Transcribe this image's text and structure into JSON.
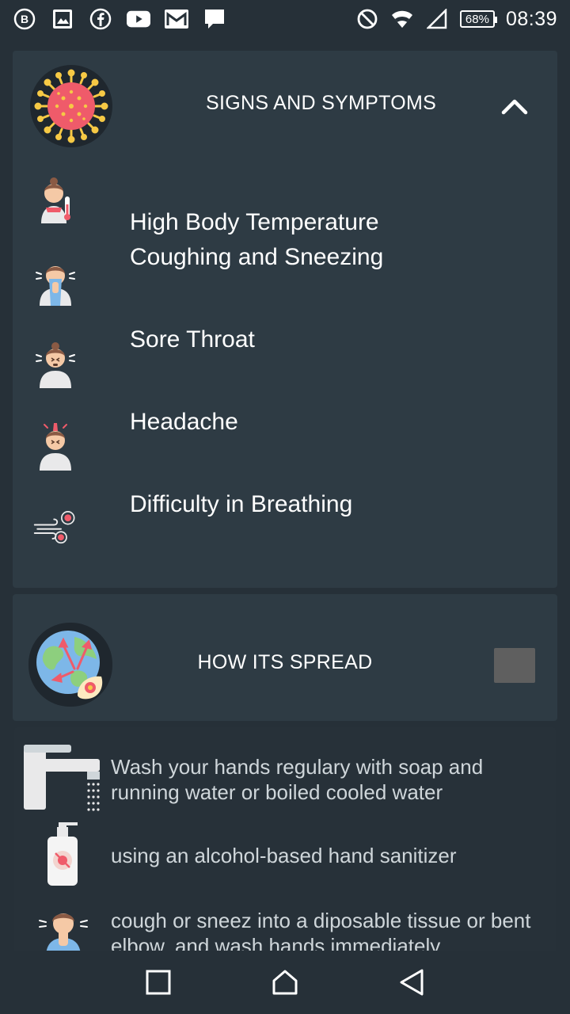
{
  "status_bar": {
    "left_icons": [
      "b-circle-icon",
      "image-icon",
      "facebook-icon",
      "youtube-icon",
      "gmail-icon",
      "chat-icon"
    ],
    "right_icons": [
      "do-not-disturb-icon",
      "wifi-icon",
      "signal-icon"
    ],
    "battery": "68%",
    "time": "08:39"
  },
  "signs_card": {
    "title": "SIGNS AND SYMPTOMS",
    "expanded": true,
    "items": [
      {
        "label": "High Body Temperature",
        "icon": "fever-person-icon"
      },
      {
        "label": "Coughing and Sneezing",
        "icon": "sneezing-person-icon"
      },
      {
        "label": "Sore Throat",
        "icon": "sore-throat-person-icon"
      },
      {
        "label": "Headache",
        "icon": "headache-person-icon"
      },
      {
        "label": "Difficulty in Breathing",
        "icon": "breathing-virus-icon"
      }
    ]
  },
  "spread_card": {
    "title": "HOW ITS SPREAD"
  },
  "prevention": {
    "items": [
      {
        "text": "Wash your hands regulary with soap and running water or boiled cooled water",
        "icon": "faucet-icon"
      },
      {
        "text": "using an alcohol-based hand sanitizer",
        "icon": "sanitizer-icon"
      },
      {
        "text": "cough or sneez into a diposable tissue or bent elbow, and wash hands immediately",
        "icon": "sneeze-elbow-icon"
      }
    ]
  },
  "nav_bar": {
    "buttons": [
      "recents",
      "home",
      "back"
    ]
  },
  "colors": {
    "background": "#263038",
    "card": "#2e3b44",
    "text": "#ffffff",
    "muted_text": "#cfd6da",
    "virus": "#ef5b6a",
    "virus_spikes": "#f6c945"
  }
}
